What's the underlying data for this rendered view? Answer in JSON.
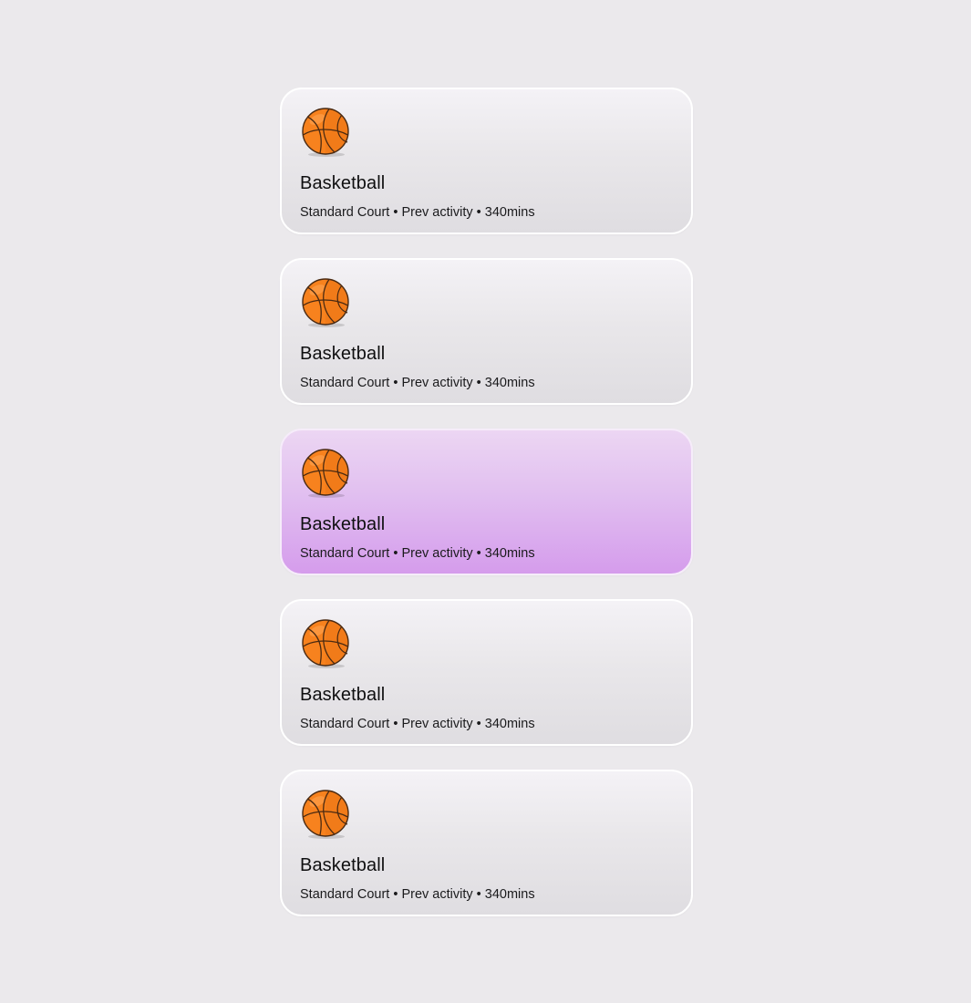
{
  "activities": [
    {
      "title": "Basketball",
      "meta": "Standard Court • Prev activity • 340mins",
      "icon": "basketball-icon",
      "selected": false
    },
    {
      "title": "Basketball",
      "meta": "Standard Court • Prev activity • 340mins",
      "icon": "basketball-icon",
      "selected": false
    },
    {
      "title": "Basketball",
      "meta": "Standard Court • Prev activity • 340mins",
      "icon": "basketball-icon",
      "selected": true
    },
    {
      "title": "Basketball",
      "meta": "Standard Court • Prev activity • 340mins",
      "icon": "basketball-icon",
      "selected": false
    },
    {
      "title": "Basketball",
      "meta": "Standard Court • Prev activity • 340mins",
      "icon": "basketball-icon",
      "selected": false
    }
  ],
  "colors": {
    "background": "#ebe9ec",
    "card": "#e9e7ea",
    "selected_card": "#ddb0ef",
    "ball": "#f28a22"
  }
}
